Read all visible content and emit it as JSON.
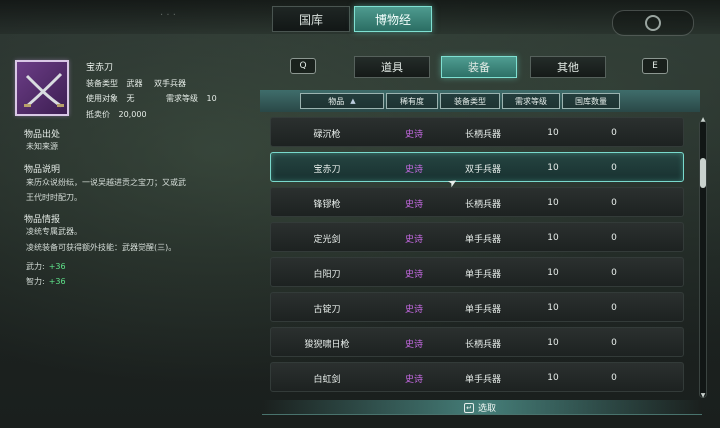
{
  "top": {
    "deco_text": "· · ·",
    "tabs": [
      {
        "label": "国库",
        "active": false
      },
      {
        "label": "博物经",
        "active": true
      }
    ]
  },
  "detail": {
    "item_name": "宝赤刀",
    "equip_type_label": "装备类型",
    "equip_type_value": "武器",
    "weapon_class": "双手兵器",
    "use_target_label": "使用对象",
    "use_target_value": "无",
    "req_level_label": "需求等级",
    "req_level_value": "10",
    "sell_price_label": "抵卖价",
    "sell_price_value": "20,000",
    "origin_title": "物品出处",
    "origin_text": "未知来源",
    "desc_title": "物品说明",
    "desc_lines": [
      "来历众说纷纭，一说吴越进贡之宝刀；又或武",
      "王代时时配刀。"
    ],
    "info_title": "物品情报",
    "info_lines": [
      "凌统专属武器。",
      "凌统装备可获得额外技能：武器觉醒(三)。"
    ],
    "stats": [
      {
        "label": "武力:",
        "value": "+36"
      },
      {
        "label": "智力:",
        "value": "+36"
      }
    ],
    "accent_color": "#5fe38a",
    "portrait_icon": "crossed-sabers-icon"
  },
  "categories": {
    "left_key": "Q",
    "right_key": "E",
    "tabs": [
      {
        "label": "道具",
        "active": false
      },
      {
        "label": "装备",
        "active": true
      },
      {
        "label": "其他",
        "active": false
      }
    ]
  },
  "table": {
    "headers": [
      "物品",
      "稀有度",
      "装备类型",
      "需求等级",
      "国库数量"
    ],
    "sort_icon": "▲",
    "rows": [
      {
        "name": "碌沉枪",
        "rarity": "史诗",
        "type": "长柄兵器",
        "level": "10",
        "qty": "0",
        "selected": false
      },
      {
        "name": "宝赤刀",
        "rarity": "史诗",
        "type": "双手兵器",
        "level": "10",
        "qty": "0",
        "selected": true
      },
      {
        "name": "锋镠枪",
        "rarity": "史诗",
        "type": "长柄兵器",
        "level": "10",
        "qty": "0",
        "selected": false
      },
      {
        "name": "定光剑",
        "rarity": "史诗",
        "type": "单手兵器",
        "level": "10",
        "qty": "0",
        "selected": false
      },
      {
        "name": "白阳刀",
        "rarity": "史诗",
        "type": "单手兵器",
        "level": "10",
        "qty": "0",
        "selected": false
      },
      {
        "name": "古锭刀",
        "rarity": "史诗",
        "type": "单手兵器",
        "level": "10",
        "qty": "0",
        "selected": false
      },
      {
        "name": "狻猊啸日枪",
        "rarity": "史诗",
        "type": "长柄兵器",
        "level": "10",
        "qty": "0",
        "selected": false
      },
      {
        "name": "白虹剑",
        "rarity": "史诗",
        "type": "单手兵器",
        "level": "10",
        "qty": "0",
        "selected": false
      }
    ],
    "rarity_color": "#c86be6"
  },
  "footer": {
    "select_key": "↵",
    "select_label": "选取"
  }
}
